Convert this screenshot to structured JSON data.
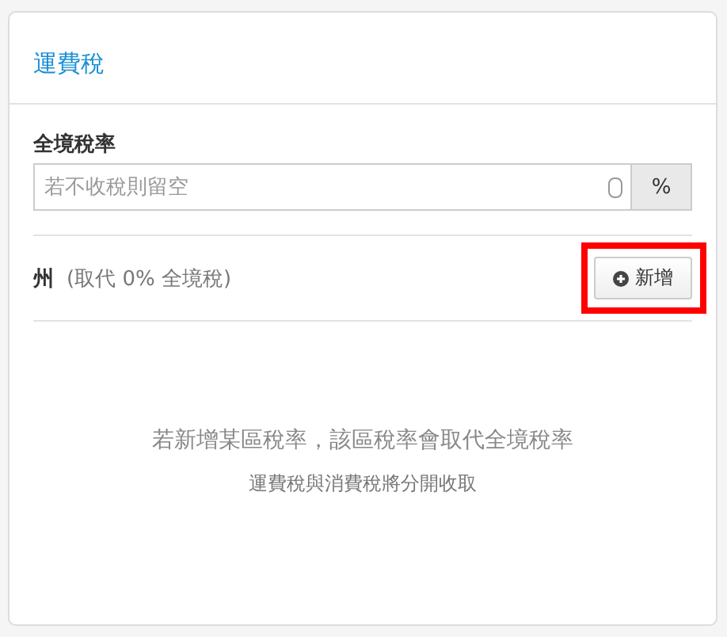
{
  "card": {
    "title": "運費稅"
  },
  "rate_field": {
    "label": "全境稅率",
    "placeholder": "若不收稅則留空",
    "unit": "%"
  },
  "region_row": {
    "label": "州",
    "note": "(取代 0% 全境稅)",
    "button": "新增"
  },
  "empty_state": {
    "headline": "若新增某區稅率，該區稅率會取代全境稅率",
    "subtext": "運費稅與消費稅將分開收取"
  }
}
